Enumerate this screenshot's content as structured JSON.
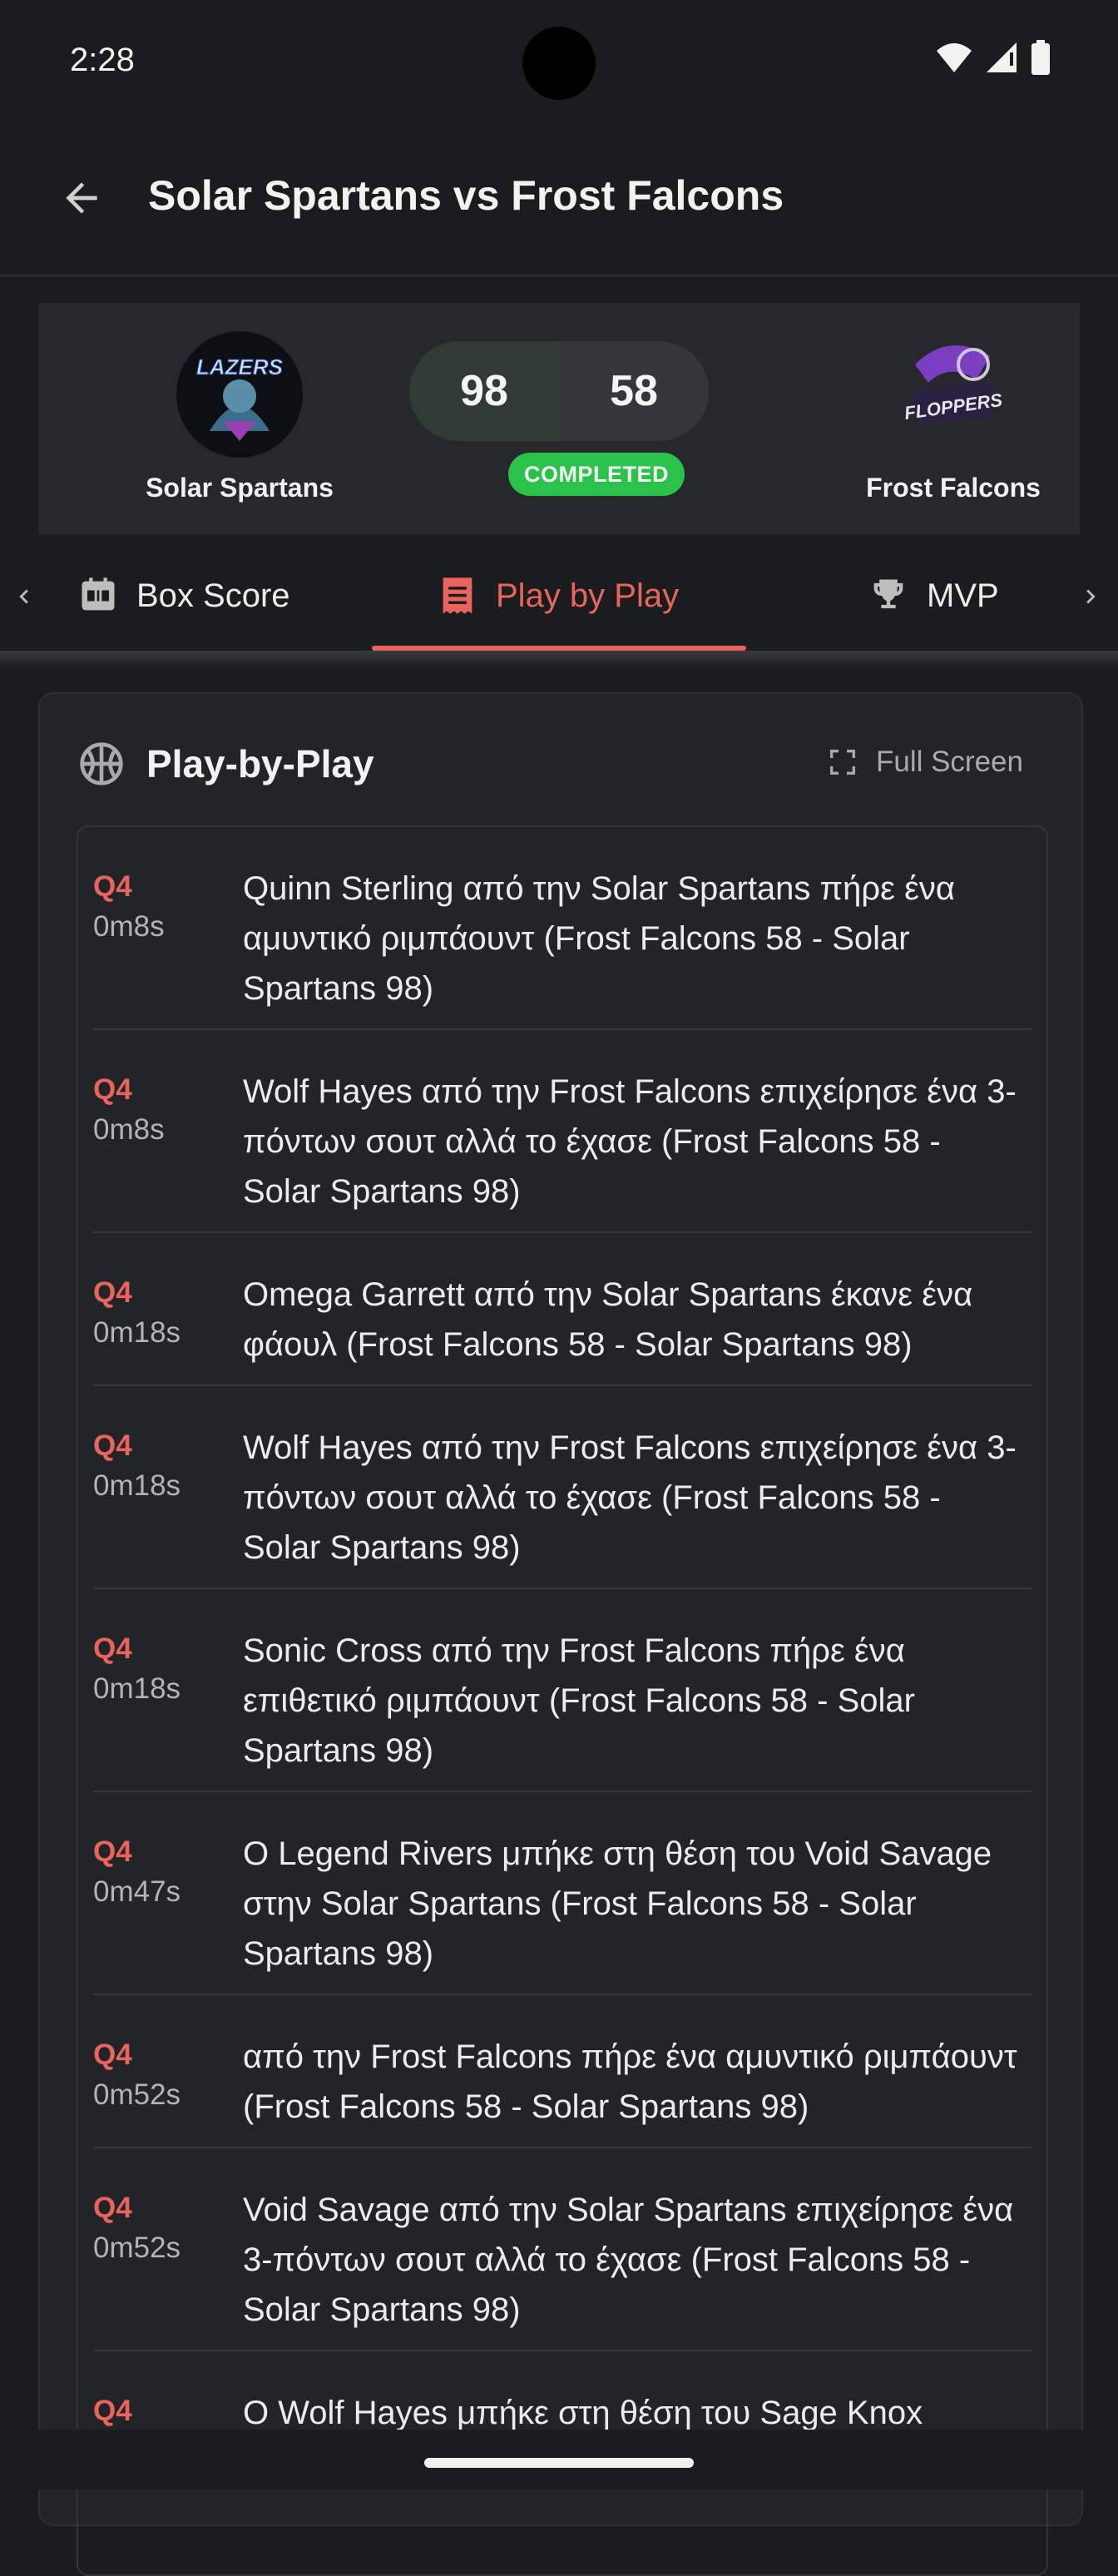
{
  "status_bar": {
    "time": "2:28"
  },
  "app_bar": {
    "title": "Solar Spartans vs Frost Falcons"
  },
  "score_card": {
    "home": {
      "name": "Solar Spartans",
      "logo_text": "LAZERS",
      "score": "98"
    },
    "away": {
      "name": "Frost Falcons",
      "logo_text": "FLOPPERS",
      "score": "58"
    },
    "status": "COMPLETED",
    "status_color": "#2bc24a"
  },
  "tabs": [
    {
      "label": "Box Score",
      "icon": "scoreboard-icon",
      "active": false
    },
    {
      "label": "Play by Play",
      "icon": "receipt-list-icon",
      "active": true
    },
    {
      "label": "MVP",
      "icon": "trophy-icon",
      "active": false
    }
  ],
  "accent_color": "#e8645c",
  "pbp": {
    "title": "Play-by-Play",
    "fullscreen_label": "Full Screen",
    "plays": [
      {
        "quarter": "Q4",
        "time": "0m8s",
        "text": "Quinn Sterling από την Solar Spartans πήρε ένα αμυντικό ριμπάουντ (Frost Falcons 58 - Solar Spartans 98)"
      },
      {
        "quarter": "Q4",
        "time": "0m8s",
        "text": "Wolf Hayes από την Frost Falcons επιχείρησε ένα 3-πόντων σουτ αλλά το έχασε (Frost Falcons 58 - Solar Spartans 98)"
      },
      {
        "quarter": "Q4",
        "time": "0m18s",
        "text": "Omega Garrett από την Solar Spartans έκανε ένα φάουλ (Frost Falcons 58 - Solar Spartans 98)"
      },
      {
        "quarter": "Q4",
        "time": "0m18s",
        "text": "Wolf Hayes από την Frost Falcons επιχείρησε ένα 3-πόντων σουτ αλλά το έχασε (Frost Falcons 58 - Solar Spartans 98)"
      },
      {
        "quarter": "Q4",
        "time": "0m18s",
        "text": "Sonic Cross από την Frost Falcons πήρε ένα επιθετικό ριμπάουντ (Frost Falcons 58 - Solar Spartans 98)"
      },
      {
        "quarter": "Q4",
        "time": "0m47s",
        "text": "Ο Legend Rivers μπήκε στη θέση του Void Savage στην Solar Spartans (Frost Falcons 58 - Solar Spartans 98)"
      },
      {
        "quarter": "Q4",
        "time": "0m52s",
        "text": "από την Frost Falcons πήρε ένα αμυντικό ριμπάουντ (Frost Falcons 58 - Solar Spartans 98)"
      },
      {
        "quarter": "Q4",
        "time": "0m52s",
        "text": "Void Savage από την Solar Spartans επιχείρησε ένα 3-πόντων σουτ αλλά το έχασε (Frost Falcons 58 - Solar Spartans 98)"
      },
      {
        "quarter": "Q4",
        "time": "",
        "text": "Ο Wolf Hayes μπήκε στη θέση του Sage Knox"
      }
    ]
  }
}
